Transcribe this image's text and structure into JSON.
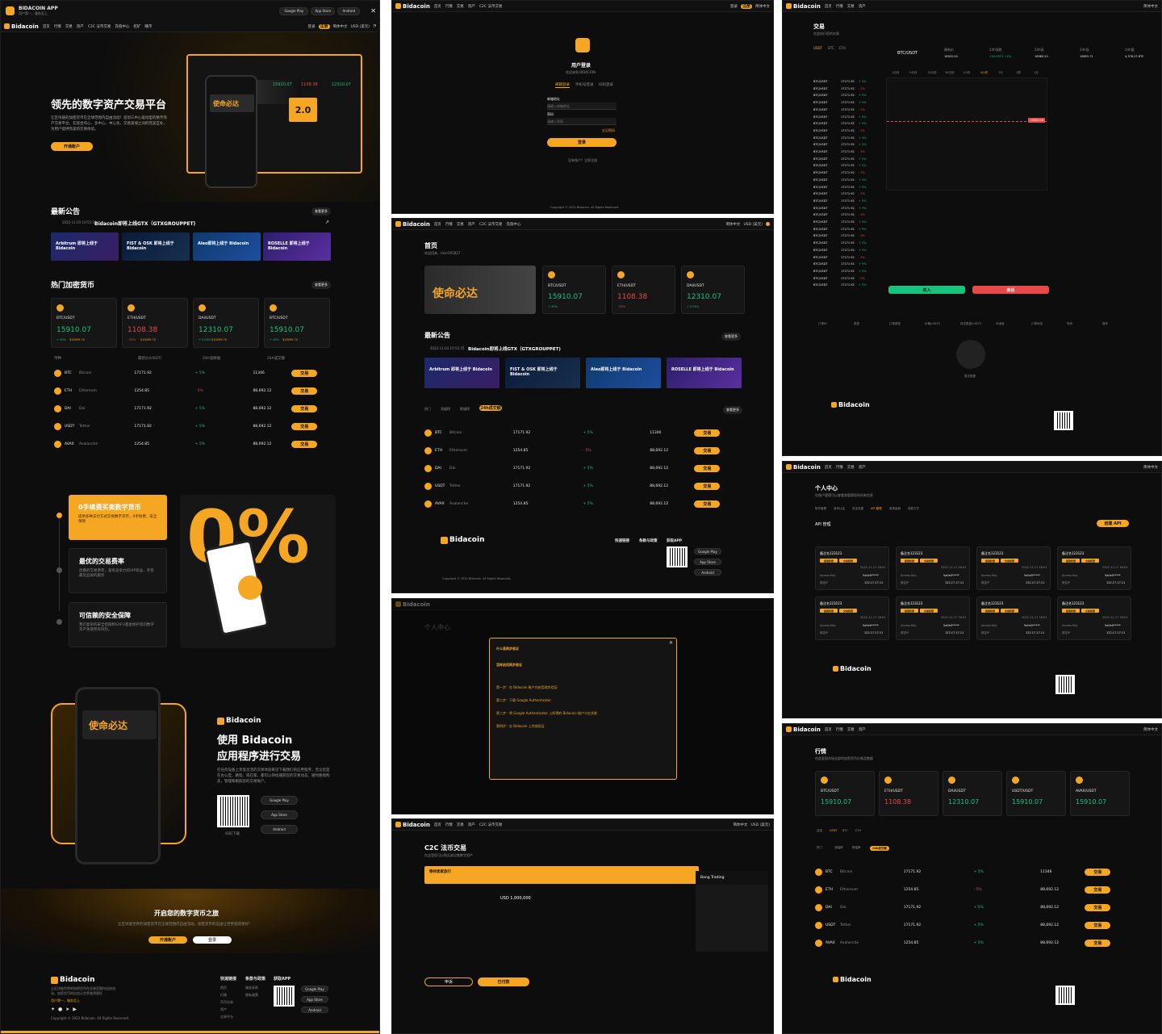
{
  "app": {
    "brand": "Bidacoin",
    "download_title": "BIDACOIN APP",
    "download_sub": "用户第一，服务至上",
    "google_play": "Google Play",
    "app_store": "App Store",
    "android": "Android"
  },
  "nav": {
    "items": [
      "首页",
      "行情",
      "交易",
      "资产",
      "C2C 法币交易",
      "充值中心",
      "挖矿",
      "赚币",
      "理财",
      "打新",
      "活动",
      "公告",
      "更多"
    ],
    "login": "登录",
    "register": "注册",
    "lang": "简体中文",
    "currency": "USD (美元)"
  },
  "hero": {
    "title": "领先的数字资产交易平台",
    "desc": "让区块链的加密货币在全球范围内自由流动！首创三中心驱动型的数字资产交易平台，实现合作心、多中心、中心化、交易高线之间的完美互补，为用户提供完美的交易体验。",
    "cta": "开通账户",
    "mock_card_big": "2.0",
    "mock_price1": "15910.07",
    "mock_price2": "1108.38",
    "mock_price3": "12310.07",
    "phone_slogan": "使命必达"
  },
  "announce": {
    "title": "最新公告",
    "more": "查看更多",
    "date": "2022-11-03 10:55:35",
    "text": "Bidacoin即将上线GTX（GTXGROUPPET)",
    "banners": [
      "Arbitrum 即将上线于 Bidacoin",
      "FIST & OSK 即将上线于 Bidacoin",
      "Aleo即将上线于 Bidacoin",
      "ROSELLE 即将上线于 Bidacoin"
    ]
  },
  "hot": {
    "title": "热门加密货币",
    "more": "查看更多",
    "cards": [
      {
        "pair": "BTC/USDT",
        "price": "15910.07",
        "chg": "+ 40%",
        "vol": "$15099.70",
        "color": "#19c37d"
      },
      {
        "pair": "ETH/USDT",
        "price": "1108.38",
        "chg": "- 85%",
        "vol": "$15099.70",
        "color": "#e84848"
      },
      {
        "pair": "DAI/USDT",
        "price": "12310.07",
        "chg": "+ 0.05%",
        "vol": "$15099.70",
        "color": "#19c37d"
      },
      {
        "pair": "BTC/USDT",
        "price": "15910.07",
        "chg": "+ 40%",
        "vol": "$15099.70",
        "color": "#19c37d"
      }
    ],
    "headers": [
      "币种",
      "最新价(USDT)",
      "24h涨跌幅",
      "24h成交额"
    ],
    "rows": [
      {
        "sym": "BTC",
        "name": "Bitcoin",
        "price": "17171.92",
        "chg": "+ 5%",
        "vol": "11346",
        "up": true
      },
      {
        "sym": "ETH",
        "name": "Ethereum",
        "price": "1254.85",
        "chg": "- 5%",
        "vol": "88,692.12",
        "up": false
      },
      {
        "sym": "DAI",
        "name": "Dai",
        "price": "17171.92",
        "chg": "+ 5%",
        "vol": "88,692.12",
        "up": true
      },
      {
        "sym": "USDT",
        "name": "Tether",
        "price": "17171.92",
        "chg": "+ 5%",
        "vol": "88,692.12",
        "up": true
      },
      {
        "sym": "AVAX",
        "name": "Avalanche",
        "price": "1254.85",
        "chg": "+ 5%",
        "vol": "88,692.12",
        "up": true
      }
    ],
    "trade": "交易"
  },
  "features": [
    {
      "title": "0手续费买卖数字货币",
      "desc": "提供多种支付方式交易数字货币，0手续费，安全保障"
    },
    {
      "title": "最优的交易费率",
      "desc": "优惠的交易费率，富有竞争力的VIP权益，享受最优品质的服务"
    },
    {
      "title": "可信赖的安全保障",
      "desc": "我们复杂的安全措施和SAFU基金保护您的数字资产免受所有风险。"
    }
  ],
  "big_zero": "0%",
  "mobile": {
    "title1": "使用 Bidacoin",
    "title2": "应用程序进行交易",
    "desc": "在任何设备上享受灵活的交易体验来见下载我们的应用程序，无论您是在办公室、路程、或在家，都可以持续捕获您的交易动态，随时随地购卖，管理和跟踪您的交易账户。",
    "scan": "扫码下载"
  },
  "journey": {
    "title": "开启您的数字货币之旅",
    "desc": "让区块链世界的加密货币在全球范围内自由流动，加密货币的自由让世界变得更好!",
    "open": "开通账户",
    "login": "登录"
  },
  "footer": {
    "tagline": "让区块链世界的加密货币在全球范围内自由流动，加密货币的自由让世界变得更好",
    "slogan": "用户第一，服务至上",
    "copyright": "Copyright © 2022 Bidacoin. All Rights Reserved.",
    "cols": [
      {
        "title": "快速链接",
        "items": [
          "首页",
          "行情",
          "币币交易",
          "资产",
          "交易平台"
        ]
      },
      {
        "title": "条款与政策",
        "items": [
          "服务条款",
          "隐私政策"
        ]
      },
      {
        "title": "获取APP",
        "items": []
      }
    ]
  },
  "login": {
    "title": "用户登录",
    "sub": "欢迎来到 BIDACOIN",
    "tabs": [
      "邮箱登录",
      "手机号登录",
      "扫码登录"
    ],
    "email_label": "邮箱地址",
    "email_ph": "请输入邮箱地址",
    "pwd_label": "密码",
    "pwd_ph": "请输入密码",
    "forgot": "忘记密码",
    "submit": "登录",
    "noacc": "没有账户？立即注册"
  },
  "home": {
    "title": "首页",
    "welcome": "欢迎回来，User205827",
    "tabs": [
      "热门",
      "涨幅榜",
      "跌幅榜",
      "24h成交额"
    ]
  },
  "trade": {
    "title": "交易",
    "sub": "在此执行您的交易",
    "pair": "BTC/USDT",
    "stats": [
      {
        "k": "最新价",
        "v": "16920.00"
      },
      {
        "k": "24h涨跌",
        "v": "+20.0371 +1%"
      },
      {
        "k": "24h高",
        "v": "16989.20"
      },
      {
        "k": "24h低",
        "v": "16855.71"
      },
      {
        "k": "24h量",
        "v": "4,378.23 BTC"
      }
    ],
    "intervals": [
      "1分钟",
      "5分钟",
      "15分钟",
      "30分钟",
      "1小时",
      "4小时",
      "1天",
      "1周",
      "1月"
    ],
    "buy": "买入",
    "sell": "卖出",
    "empty": "暂无数据",
    "cols": [
      "订单ID",
      "类型",
      "订单类型",
      "价格(USDT)",
      "成交数量(USDT)",
      "手续费",
      "订单状态",
      "时间",
      "操作"
    ],
    "price_mark": "16920.00",
    "markets": [
      "USDT",
      "BTC",
      "ETH"
    ]
  },
  "profile": {
    "title": "个人中心",
    "sub": "在账户管理可以查看和管理您的所有信息",
    "tabs": [
      "账号管理",
      "身份认证",
      "安全设置",
      "API 管理",
      "邀请返佣",
      "收款方式"
    ],
    "api_title": "API 管理",
    "create": "创建 API",
    "card_name": "备注名123123",
    "tags": [
      "提现权限",
      "交易权限",
      "只读权限"
    ],
    "access": "Access Key",
    "access_v": "5a0e0*****",
    "ip": "绑定IP",
    "ip_v": "122.17.17.11",
    "date": "2022-11-17 16:01"
  },
  "dialog": {
    "title": "什么是两步验证",
    "h2": "怎样启用两步验证",
    "h3": "第一步：在 Bidacoin 账户内启用两步验证",
    "h4": "第二步：下载 Google Authenticator",
    "h5": "第三步：将 Google Authenticator 上所得的 Bidacoin 账户与它关联",
    "h6": "第四步：在 Bidacoin 上完成验证"
  },
  "c2c": {
    "title": "C2C 法币交易",
    "sub": "在这里您可以购买或出售数字资产",
    "pending": "等待卖家放行",
    "amount": "USD 1,000,000",
    "merchant": "Bang Trading",
    "cancel": "申诉",
    "confirm": "已付款"
  },
  "market": {
    "title": "行情",
    "sub": "在此发现市场全部的加密货币价格及数据",
    "cards": [
      {
        "pair": "BTC/USDT",
        "price": "15910.07",
        "color": "#19c37d"
      },
      {
        "pair": "ETH/USDT",
        "price": "1108.38",
        "color": "#e84848"
      },
      {
        "pair": "DAI/USDT",
        "price": "12310.07",
        "color": "#19c37d"
      },
      {
        "pair": "USDT/USDT",
        "price": "15910.07",
        "color": "#19c37d"
      },
      {
        "pair": "AVAX/USDT",
        "price": "15910.07",
        "color": "#19c37d"
      }
    ],
    "segs": [
      "自选",
      "USDT",
      "BTC",
      "ETH"
    ]
  }
}
